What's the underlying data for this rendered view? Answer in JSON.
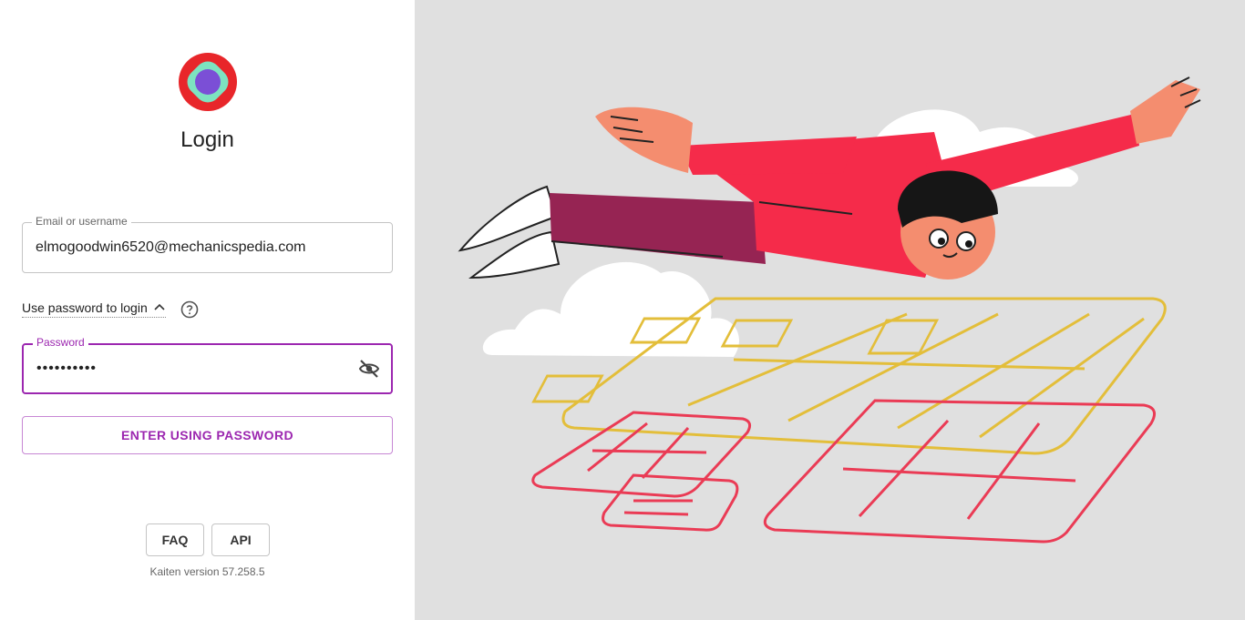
{
  "login": {
    "title": "Login",
    "email": {
      "label": "Email or username",
      "value": "elmogoodwin6520@mechanicspedia.com"
    },
    "password_toggle": "Use password to login",
    "password": {
      "label": "Password",
      "value": "••••••••••"
    },
    "enter_button": "ENTER USING PASSWORD",
    "faq_button": "FAQ",
    "api_button": "API",
    "version": "Kaiten version 57.258.5"
  },
  "colors": {
    "accent": "#9c27b0",
    "illustration_bg": "#e0e0e0",
    "logo_outer": "#e8262a",
    "logo_mid": "#7de3c0",
    "logo_inner": "#7b4fd6"
  },
  "icons": [
    "logo-icon",
    "chevron-up-icon",
    "help-circle-icon",
    "eye-off-icon"
  ]
}
